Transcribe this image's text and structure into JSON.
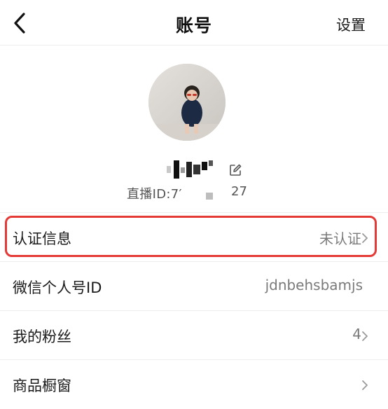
{
  "nav": {
    "title": "账号",
    "settings_label": "设置"
  },
  "profile": {
    "live_id_prefix": "直播ID:7′",
    "live_id_suffix": "27"
  },
  "rows": [
    {
      "label": "认证信息",
      "value": "未认证",
      "has_chevron": true
    },
    {
      "label": "微信个人号ID",
      "value": "jdnbehsbamjs",
      "has_chevron": false
    },
    {
      "label": "我的粉丝",
      "value": "4",
      "has_chevron": true
    },
    {
      "label": "商品橱窗",
      "value": "",
      "has_chevron": true
    }
  ],
  "colors": {
    "highlight": "#e53935",
    "divider": "#ededed",
    "secondary_text": "#7a7a7a"
  },
  "icons": {
    "back": "chevron-left-icon",
    "edit": "edit-icon",
    "row_arrow": "chevron-right-icon"
  }
}
